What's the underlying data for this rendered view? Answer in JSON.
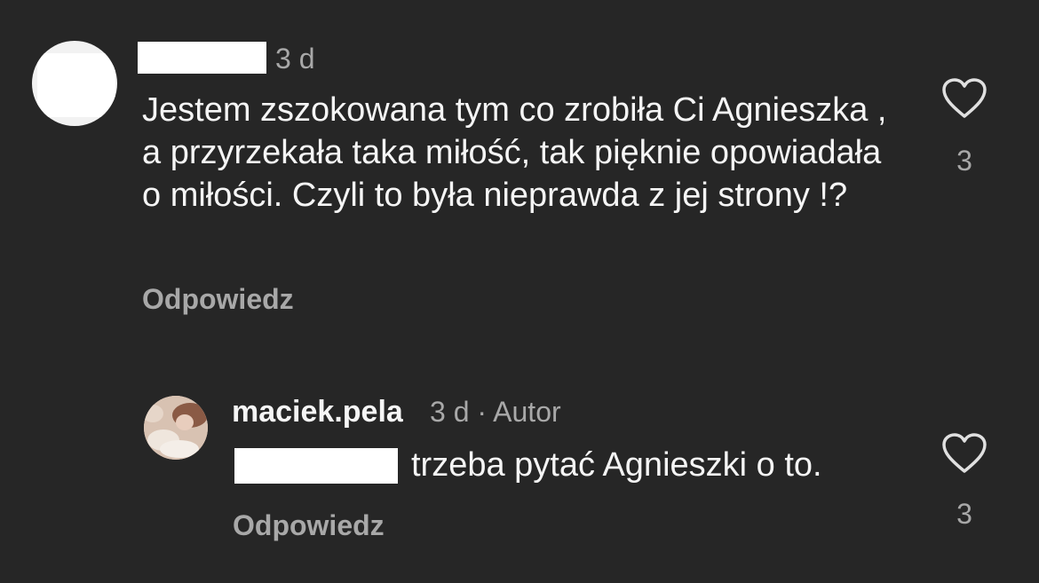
{
  "comments": [
    {
      "time": "3 d",
      "text": "Jestem zszokowana tym co zrobiła Ci Agnieszka , a przyrzekała taka miłość, tak pięknie opowiadała o miłości. Czyli to była nieprawda z jej strony !?",
      "reply_label": "Odpowiedz",
      "likes": "3"
    },
    {
      "username": "maciek.pela",
      "meta": "3 d · Autor",
      "text": "trzeba pytać Agnieszki o to.",
      "reply_label": "Odpowiedz",
      "likes": "3"
    }
  ],
  "icons": {
    "like": "heart-outline-icon"
  },
  "colors": {
    "background": "#262626",
    "primary_text": "#f5f5f5",
    "secondary_text": "#a8a8a8"
  }
}
